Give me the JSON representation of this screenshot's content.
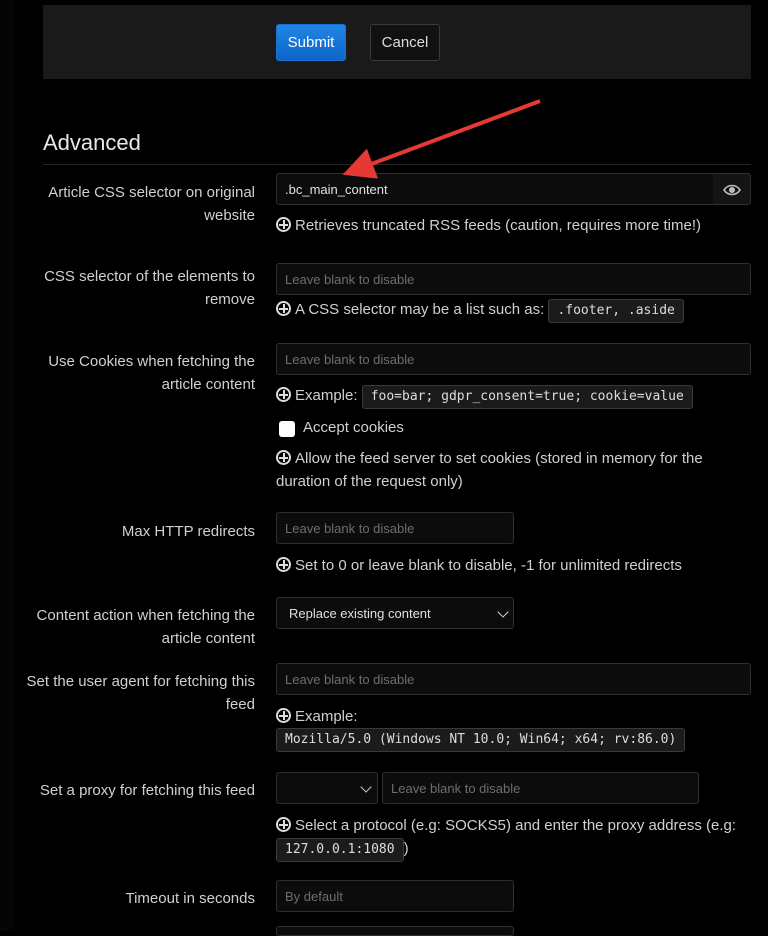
{
  "actions": {
    "submit_label": "Submit",
    "cancel_label": "Cancel"
  },
  "section": {
    "title": "Advanced"
  },
  "article_css": {
    "label": "Article CSS selector on original website",
    "value": ".bc_main_content",
    "help": "Retrieves truncated RSS feeds (caution, requires more time!)"
  },
  "css_remove": {
    "label": "CSS selector of the elements to remove",
    "placeholder": "Leave blank to disable",
    "help_prefix": "A CSS selector may be a list such as:",
    "help_code": ".footer, .aside"
  },
  "cookies": {
    "label": "Use Cookies when fetching the article content",
    "placeholder": "Leave blank to disable",
    "help_prefix": "Example:",
    "help_code": "foo=bar; gdpr_consent=true; cookie=value",
    "accept_label": "Accept cookies",
    "accept_checked": false,
    "accept_help": "Allow the feed server to set cookies (stored in memory for the duration of the request only)"
  },
  "redirects": {
    "label": "Max HTTP redirects",
    "placeholder": "Leave blank to disable",
    "help": "Set to 0 or leave blank to disable, -1 for unlimited redirects"
  },
  "content_action": {
    "label": "Content action when fetching the article content",
    "selected": "Replace existing content"
  },
  "user_agent": {
    "label": "Set the user agent for fetching this feed",
    "placeholder": "Leave blank to disable",
    "help_prefix": "Example:",
    "help_code": "Mozilla/5.0 (Windows NT 10.0; Win64; x64; rv:86.0)"
  },
  "proxy": {
    "label": "Set a proxy for fetching this feed",
    "protocol_selected": "",
    "placeholder": "Leave blank to disable",
    "help_prefix": "Select a protocol (e.g: SOCKS5) and enter the proxy address (e.g:",
    "help_code": "127.0.0.1:1080",
    "help_suffix": ")"
  },
  "timeout": {
    "label": "Timeout in seconds",
    "placeholder": "By default"
  },
  "colors": {
    "accent": "#1976d2",
    "arrow": "#e53935",
    "background": "#000000"
  },
  "icons": {
    "help": "help-circle-icon",
    "eye": "eye-icon",
    "chevron": "chevron-down-icon"
  }
}
